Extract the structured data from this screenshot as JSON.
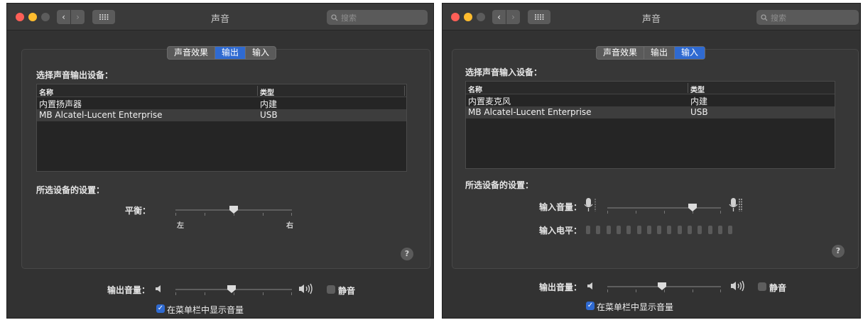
{
  "window_title": "声音",
  "search_placeholder": "搜索",
  "tabs": [
    "声音效果",
    "输出",
    "输入"
  ],
  "left": {
    "active_tab": "输出",
    "section_title": "选择声音输出设备：",
    "table": {
      "headers": [
        "名称",
        "类型"
      ],
      "rows": [
        {
          "name": "内置扬声器",
          "type": "内建"
        },
        {
          "name": "MB Alcatel-Lucent Enterprise",
          "type": "USB"
        }
      ]
    },
    "settings_title": "所选设备的设置：",
    "balance_label": "平衡：",
    "balance_left": "左",
    "balance_right": "右",
    "balance_value": 0.5
  },
  "right": {
    "active_tab": "输入",
    "section_title": "选择声音输入设备：",
    "table": {
      "headers": [
        "名称",
        "类型"
      ],
      "rows": [
        {
          "name": "内置麦克风",
          "type": "内建"
        },
        {
          "name": "MB Alcatel-Lucent Enterprise",
          "type": "USB"
        }
      ]
    },
    "settings_title": "所选设备的设置：",
    "input_volume_label": "输入音量：",
    "input_volume_value": 0.75,
    "input_level_label": "输入电平：",
    "input_level_segments": 15
  },
  "output_volume_label": "输出音量：",
  "output_volume_value": 0.48,
  "mute_label": "静音",
  "mute_checked": false,
  "show_in_menubar_label": "在菜单栏中显示音量",
  "show_in_menubar_checked": true,
  "colors": {
    "accent": "#2f6ad1",
    "window": "#323232",
    "table": "#252525"
  }
}
